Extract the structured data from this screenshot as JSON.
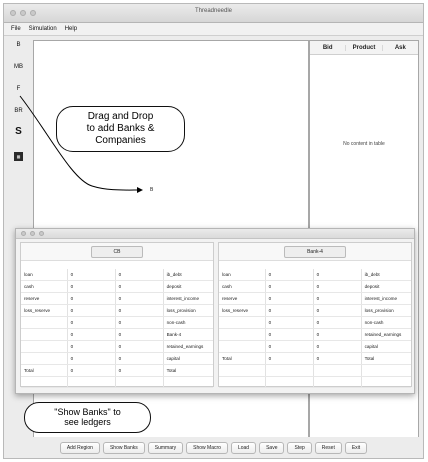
{
  "window": {
    "title": "Threadneedle"
  },
  "menu": [
    "File",
    "Simulation",
    "Help"
  ],
  "tools": [
    {
      "label": "B",
      "icon": "bank-tool-icon"
    },
    {
      "label": "MB",
      "icon": "markets-bank-tool-icon"
    },
    {
      "label": "F",
      "icon": "firm-tool-icon"
    },
    {
      "label": "BR",
      "icon": "broker-tool-icon"
    },
    {
      "label": "S",
      "icon": "stock-tool-icon"
    },
    {
      "label": "▦",
      "icon": "chart-tool-icon"
    }
  ],
  "market_table": {
    "columns": [
      "Bid",
      "Product",
      "Ask"
    ],
    "empty_text": "No content in table"
  },
  "canvas": {
    "node_label": "B"
  },
  "callouts": {
    "drag": "Drag and Drop\nto add Banks &\nCompanies",
    "show": "\"Show Banks\" to\nsee ledgers"
  },
  "ledgers": [
    {
      "name": "CB",
      "rows": [
        [
          "loan",
          "0",
          "0",
          "ib_debt"
        ],
        [
          "cash",
          "0",
          "0",
          "deposit"
        ],
        [
          "reserve",
          "0",
          "0",
          "interest_income"
        ],
        [
          "loss_reserve",
          "0",
          "0",
          "loss_provision"
        ],
        [
          "",
          "0",
          "0",
          "non-cash"
        ],
        [
          "",
          "0",
          "0",
          "Bank-4"
        ],
        [
          "",
          "0",
          "0",
          "retained_earnings"
        ],
        [
          "",
          "0",
          "0",
          "capital"
        ],
        [
          "Total",
          "0",
          "0",
          "Total"
        ],
        [
          "",
          "",
          "",
          ""
        ]
      ]
    },
    {
      "name": "Bank-4",
      "rows": [
        [
          "loan",
          "0",
          "0",
          "ib_debt"
        ],
        [
          "cash",
          "0",
          "0",
          "deposit"
        ],
        [
          "reserve",
          "0",
          "0",
          "interest_income"
        ],
        [
          "loss_reserve",
          "0",
          "0",
          "loss_provision"
        ],
        [
          "",
          "0",
          "0",
          "non-cash"
        ],
        [
          "",
          "0",
          "0",
          "retained_earnings"
        ],
        [
          "",
          "0",
          "0",
          "capital"
        ],
        [
          "Total",
          "0",
          "0",
          "Total"
        ],
        [
          "",
          "",
          "",
          ""
        ],
        [
          "",
          "",
          "",
          ""
        ]
      ]
    }
  ],
  "buttons": [
    "Add Region",
    "Show Banks",
    "Summary",
    "Show Macro",
    "Load",
    "Save",
    "Step",
    "Reset",
    "Exit"
  ]
}
